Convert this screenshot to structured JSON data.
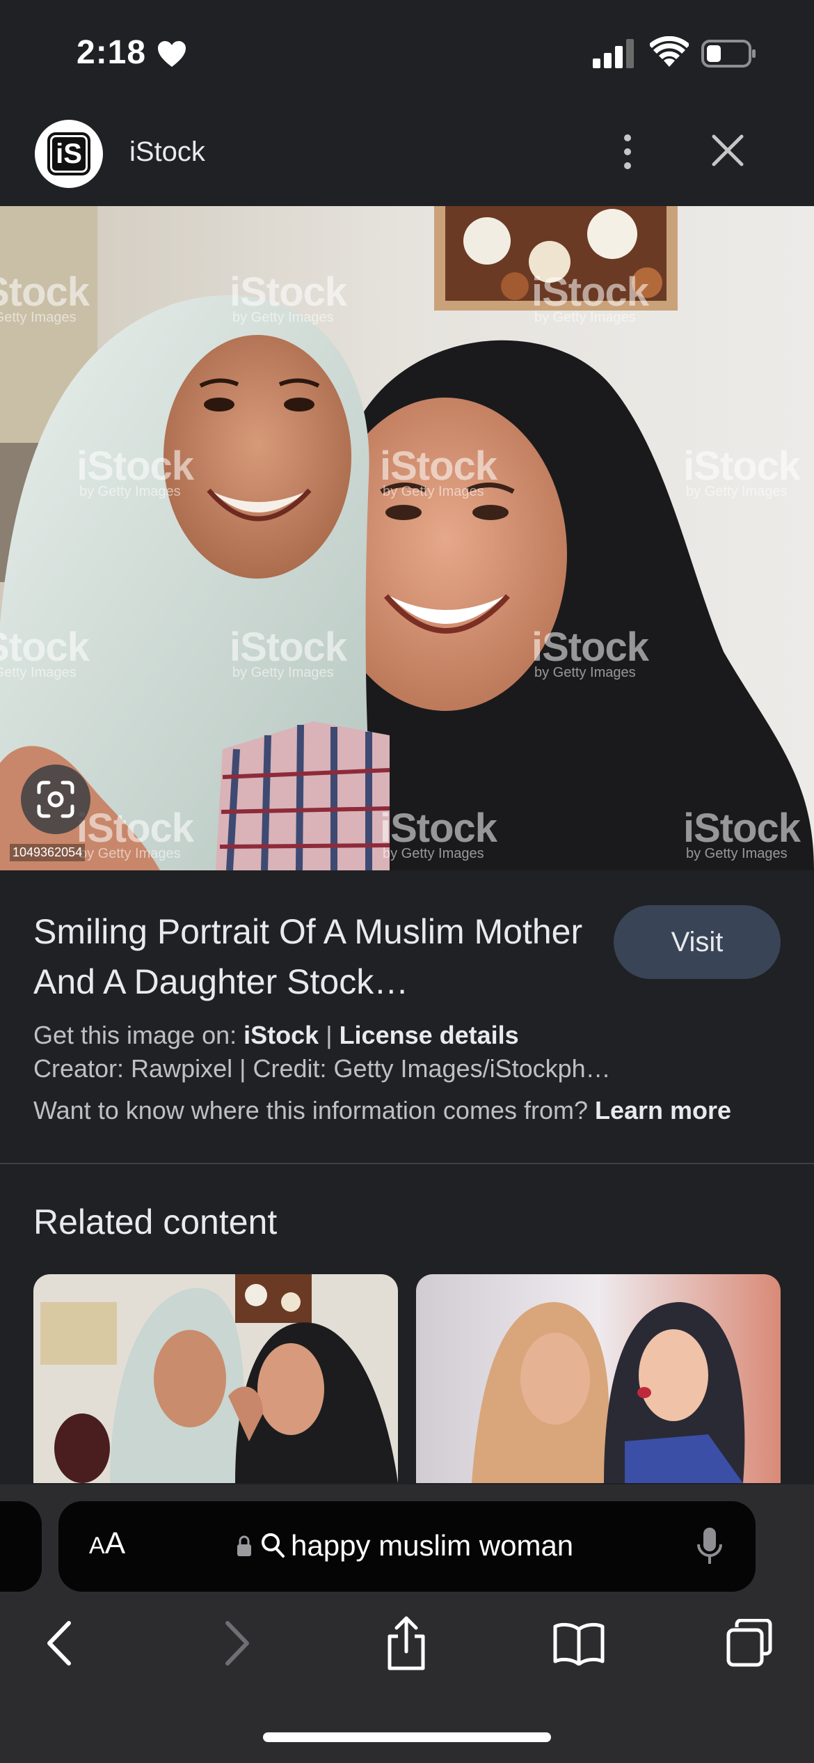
{
  "status_bar": {
    "time": "2:18"
  },
  "header": {
    "site_logo_text": "iS",
    "site_name": "iStock"
  },
  "hero": {
    "image_id": "1049362054",
    "watermark_main": "iStock",
    "watermark_sub": "by Getty Images"
  },
  "info": {
    "title": "Smiling Portrait Of A Muslim Mother And A Daughter Stock…",
    "visit_label": "Visit",
    "get_image_prefix": "Get this image on: ",
    "get_image_source": "iStock",
    "separator": " | ",
    "license_details": "License details",
    "creator_line": "Creator: Rawpixel | Credit: Getty Images/iStockph…",
    "where_info": "Want to know where this information comes from? ",
    "learn_more": "Learn more"
  },
  "related": {
    "title": "Related content"
  },
  "browser": {
    "aa_label_small": "A",
    "aa_label_large": "A",
    "address_text": "happy muslim woman"
  },
  "colors": {
    "background": "#202124",
    "visit_button": "#394457",
    "toolbar": "#2c2c2e"
  }
}
